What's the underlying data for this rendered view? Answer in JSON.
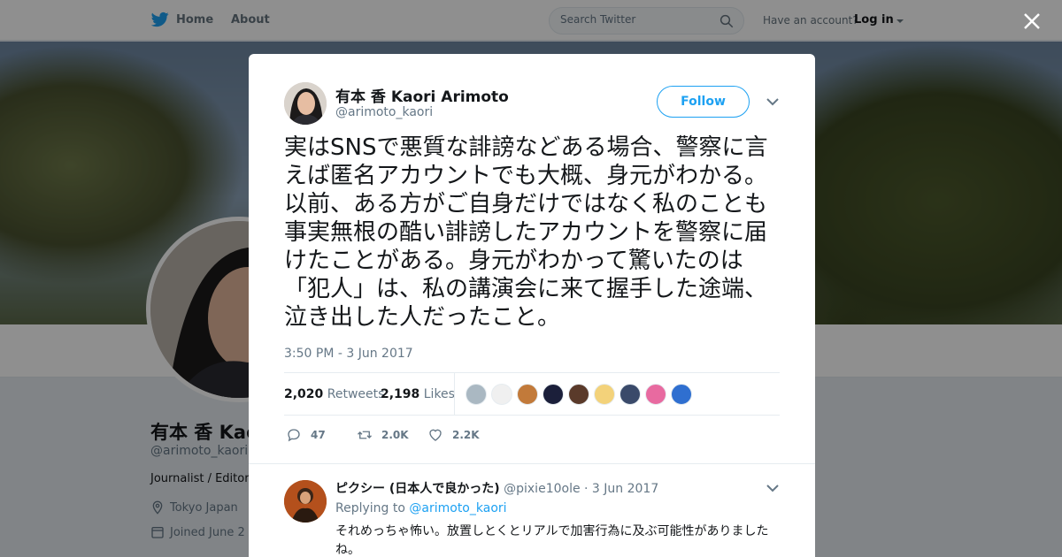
{
  "nav": {
    "home_label": "Home",
    "about_label": "About",
    "search_placeholder": "Search Twitter",
    "have_account": "Have an account?",
    "login_label": "Log in"
  },
  "profile": {
    "name": "有本 香 Kao",
    "handle": "@arimoto_kaori",
    "bio": "Journalist / Editor",
    "location": "Tokyo Japan",
    "joined": "Joined June 2"
  },
  "tweet": {
    "author_name": "有本 香 Kaori Arimoto",
    "author_handle": "@arimoto_kaori",
    "follow_label": "Follow",
    "text": "実はSNSで悪質な誹謗などある場合、警察に言えば匿名アカウントでも大概、身元がわかる。以前、ある方がご自身だけではなく私のことも事実無根の酷い誹謗したアカウントを警察に届けたことがある。身元がわかって驚いたのは「犯人」は、私の講演会に来て握手した途端、泣き出した人だったこと。",
    "timestamp": "3:50 PM - 3 Jun 2017",
    "retweets_count": "2,020",
    "retweets_label": "Retweets",
    "likes_count": "2,198",
    "likes_label": "Likes",
    "liker_colors": [
      "#aab8c2",
      "#f0f0f0",
      "#c27a3a",
      "#1b1f3a",
      "#5a3a2a",
      "#f3d27a",
      "#3a4a6a",
      "#e86aa0",
      "#2f6fd0"
    ],
    "action_reply_count": "47",
    "action_retweet_count": "2.0K",
    "action_like_count": "2.2K"
  },
  "reply": {
    "name": "ピクシー (日本人で良かった)",
    "handle": "@pixie10ole",
    "date": "· 3 Jun 2017",
    "replying_prefix": "Replying to",
    "replying_handle": "@arimoto_kaori",
    "text": "それめっちゃ怖い。放置しとくとリアルで加害行為に及ぶ可能性がありましたね。"
  },
  "colors": {
    "accent": "#1da1f2",
    "text_primary": "#14171a",
    "text_secondary": "#657786"
  },
  "icons": [
    "twitter-bird-icon",
    "search-icon",
    "caret-down-icon",
    "close-icon",
    "chevron-down-icon",
    "reply-icon",
    "retweet-icon",
    "like-icon",
    "location-icon",
    "calendar-icon"
  ]
}
